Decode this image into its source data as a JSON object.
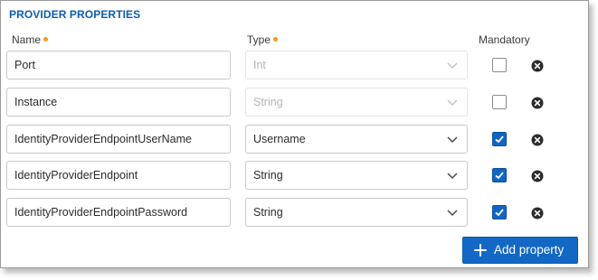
{
  "section": {
    "title": "PROVIDER PROPERTIES"
  },
  "columns": {
    "name": "Name",
    "type": "Type",
    "mandatory": "Mandatory"
  },
  "rows": [
    {
      "name": "Port",
      "type": "Int",
      "type_disabled": true,
      "mandatory": false
    },
    {
      "name": "Instance",
      "type": "String",
      "type_disabled": true,
      "mandatory": false
    },
    {
      "name": "IdentityProviderEndpointUserName",
      "type": "Username",
      "type_disabled": false,
      "mandatory": true
    },
    {
      "name": "IdentityProviderEndpoint",
      "type": "String",
      "type_disabled": false,
      "mandatory": true
    },
    {
      "name": "IdentityProviderEndpointPassword",
      "type": "String",
      "type_disabled": false,
      "mandatory": true
    }
  ],
  "actions": {
    "add_property": "Add property"
  },
  "colors": {
    "accent": "#0a5db3",
    "required_dot": "#f29b1d",
    "button": "#1268c4"
  },
  "icons": {
    "dropdown": "chevron-down-icon",
    "remove": "remove-circle-icon",
    "check": "check-icon",
    "add": "plus-icon"
  }
}
